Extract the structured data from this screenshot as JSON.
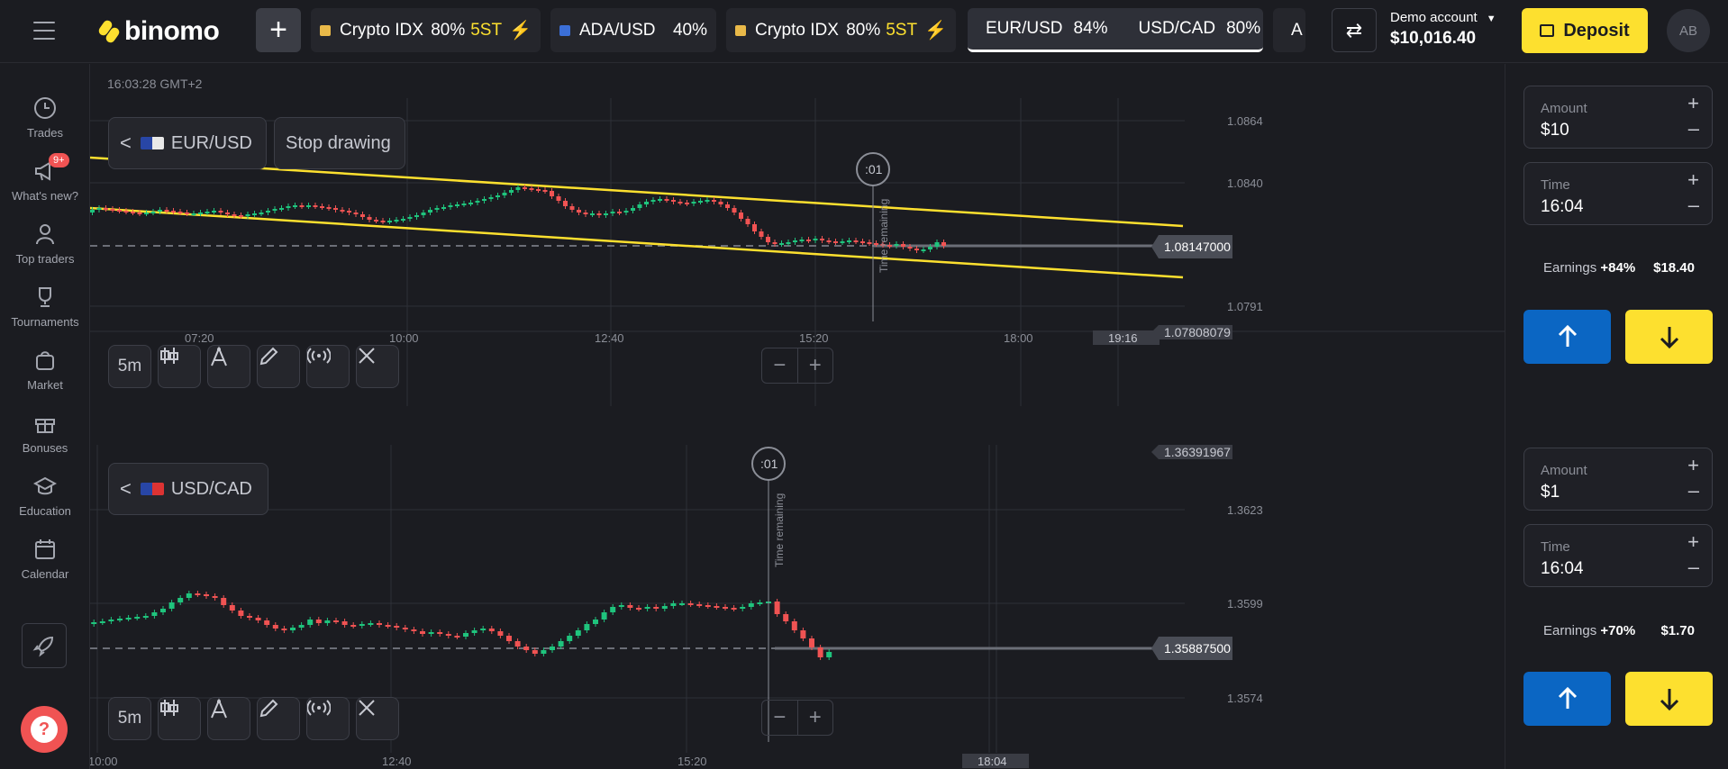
{
  "topbar": {
    "logo_text": "binomo",
    "tabs": [
      {
        "name": "Crypto IDX",
        "pct": "80%",
        "suffix": "5ST",
        "bolt": "⚡"
      },
      {
        "name": "ADA/USD",
        "pct": "40%"
      },
      {
        "name": "Crypto IDX",
        "pct": "80%",
        "suffix": "5ST",
        "bolt": "⚡"
      },
      {
        "name": "EUR/USD",
        "pct": "84%",
        "name2": "USD/CAD",
        "pct2": "80%"
      },
      {
        "name": "A"
      }
    ],
    "account_label": "Demo account",
    "balance": "$10,016.40",
    "deposit_label": "Deposit",
    "avatar_initials": "AB"
  },
  "sidebar": {
    "items": [
      {
        "label": "Trades",
        "icon": "clock-icon"
      },
      {
        "label": "What's new?",
        "icon": "megaphone-icon",
        "badge": "9+"
      },
      {
        "label": "Top traders",
        "icon": "person-icon"
      },
      {
        "label": "Tournaments",
        "icon": "trophy-icon"
      },
      {
        "label": "Market",
        "icon": "bag-icon"
      },
      {
        "label": "Bonuses",
        "icon": "gift-icon"
      },
      {
        "label": "Education",
        "icon": "graduation-cap-icon"
      },
      {
        "label": "Calendar",
        "icon": "calendar-icon"
      }
    ]
  },
  "chart1": {
    "timestamp": "16:03:28 GMT+2",
    "asset": "EUR/USD",
    "stop_drawing": "Stop drawing",
    "timeframe": "5m",
    "price_labels": [
      "1.0864",
      "1.0840",
      "1.0791"
    ],
    "current_price": "1.08147000",
    "low_price": "1.07808079",
    "time_labels": [
      "07:20",
      "10:00",
      "12:40",
      "15:20",
      "18:00"
    ],
    "expiry_time": "19:16",
    "timer": ":01",
    "timer_text": "Time remaining"
  },
  "chart2": {
    "asset": "USD/CAD",
    "timeframe": "5m",
    "price_labels": [
      "1.3623",
      "1.3599",
      "1.3574"
    ],
    "top_price": "1.36391967",
    "current_price": "1.35887500",
    "time_labels": [
      "10:00",
      "12:40",
      "15:20"
    ],
    "expiry_time": "18:04",
    "timer": ":01",
    "timer_text": "Time remaining"
  },
  "trade1": {
    "amount_label": "Amount",
    "amount": "$10",
    "time_label": "Time",
    "time": "16:04",
    "earnings_label": "Earnings",
    "earnings_pct": "+84%",
    "earnings_value": "$18.40"
  },
  "trade2": {
    "amount_label": "Amount",
    "amount": "$1",
    "time_label": "Time",
    "time": "16:04",
    "earnings_label": "Earnings",
    "earnings_pct": "+70%",
    "earnings_value": "$1.70"
  },
  "colors": {
    "up": "#1fc47d",
    "down": "#f05353",
    "accent": "#fde02f",
    "call": "#0b66c3"
  }
}
